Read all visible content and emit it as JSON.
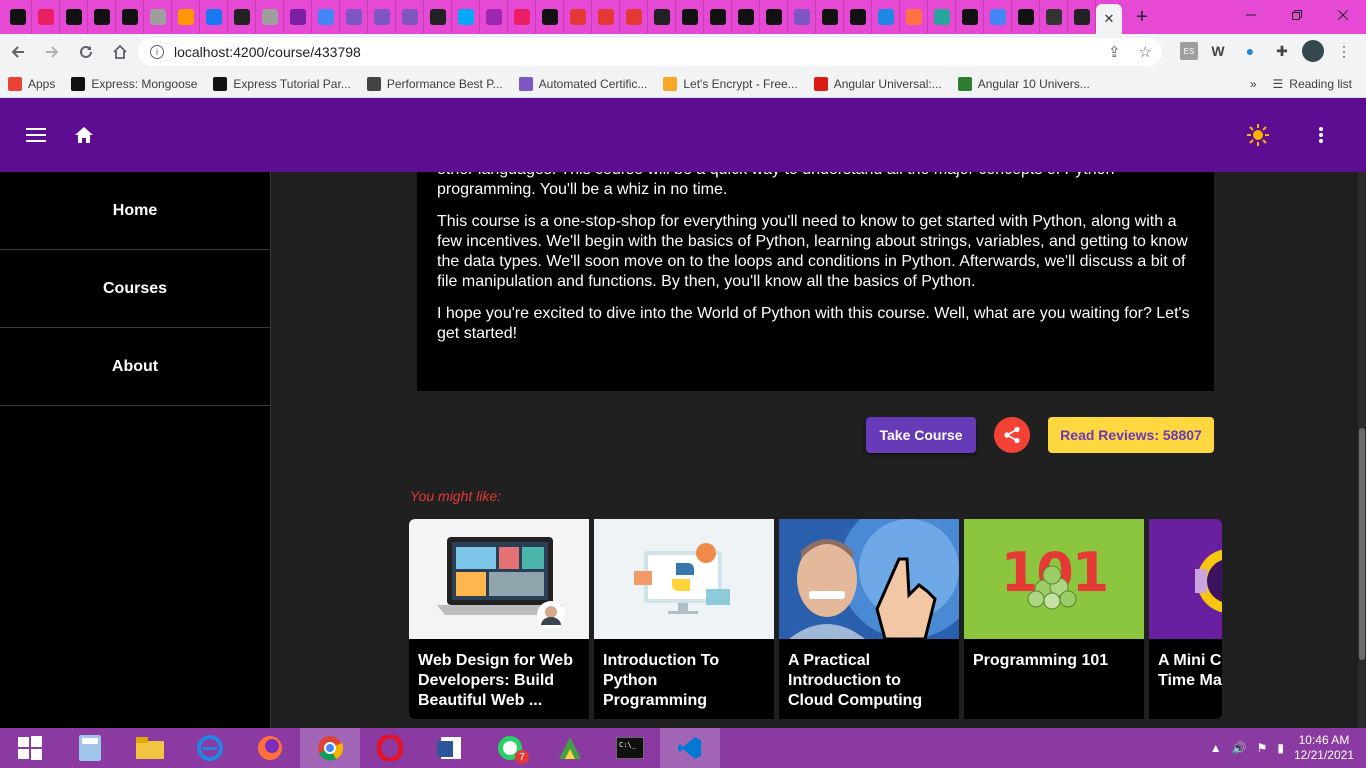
{
  "browser": {
    "active_tab_close": "✕",
    "new_tab": "+",
    "url": "localhost:4200/course/433798",
    "bookmarks": [
      {
        "label": "Apps",
        "color": "#ea4335"
      },
      {
        "label": "Express: Mongoose",
        "color": "#111111"
      },
      {
        "label": "Express Tutorial Par...",
        "color": "#111111"
      },
      {
        "label": "Performance Best P...",
        "color": "#444444"
      },
      {
        "label": "Automated Certific...",
        "color": "#7e57c2"
      },
      {
        "label": "Let's Encrypt - Free...",
        "color": "#f9a825"
      },
      {
        "label": "Angular Universal:...",
        "color": "#dd1b16"
      },
      {
        "label": "Angular 10 Univers...",
        "color": "#2e7d32"
      }
    ],
    "reading_list": "Reading list",
    "more": "»"
  },
  "toolbar": {
    "menu_icon": "menu-icon",
    "home_icon": "home-icon",
    "theme_icon": "sun-icon",
    "more_icon": "more-vert-icon",
    "color": "#5c0d91"
  },
  "sidenav": {
    "items": [
      {
        "label": "Home"
      },
      {
        "label": "Courses"
      },
      {
        "label": "About"
      }
    ]
  },
  "course": {
    "description": [
      "other languages. This course will be a quick way to understand all the major concepts of Python programming. You'll be a whiz in no time.",
      "This course is a one-stop-shop for everything you'll need to know to get started with Python, along with a few incentives. We'll begin with the basics of Python, learning about strings, variables, and getting to know the data types. We'll soon move on to the loops and conditions in Python. Afterwards, we'll discuss a bit of file manipulation and functions. By then, you'll know all the basics of Python.",
      "I hope you're excited to dive into the World of Python with this course. Well, what are you waiting for? Let's get started!"
    ],
    "take_course_label": "Take Course",
    "read_reviews_label": "Read Reviews:",
    "review_count": "58807"
  },
  "recommendations": {
    "heading": "You might like:",
    "cards": [
      {
        "title": "Web Design for Web Developers: Build Beautiful Web ..."
      },
      {
        "title": "Introduction To Python Programming"
      },
      {
        "title": "A Practical Introduction to Cloud Computing"
      },
      {
        "title": "Programming 101",
        "image_text": "101"
      },
      {
        "title": "A Mini Course on Time Management"
      }
    ]
  },
  "taskbar": {
    "time": "10:46 AM",
    "date": "12/21/2021",
    "whatsapp_badge": "7"
  },
  "colors": {
    "accent_purple": "#673ab7",
    "share_red": "#f44336",
    "reviews_yellow": "#ffd740",
    "recommend_red": "#e53935"
  }
}
